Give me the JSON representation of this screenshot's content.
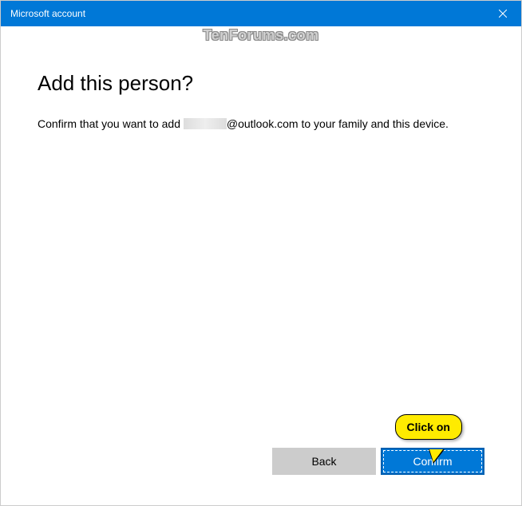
{
  "titlebar": {
    "title": "Microsoft account"
  },
  "watermark": "TenForums.com",
  "main": {
    "heading": "Add this person?",
    "confirm_prefix": "Confirm that you want to add ",
    "email_suffix": "@outlook.com",
    "confirm_suffix": " to your family and this device."
  },
  "buttons": {
    "back": "Back",
    "confirm": "Confirm"
  },
  "callout": {
    "text": "Click on"
  }
}
